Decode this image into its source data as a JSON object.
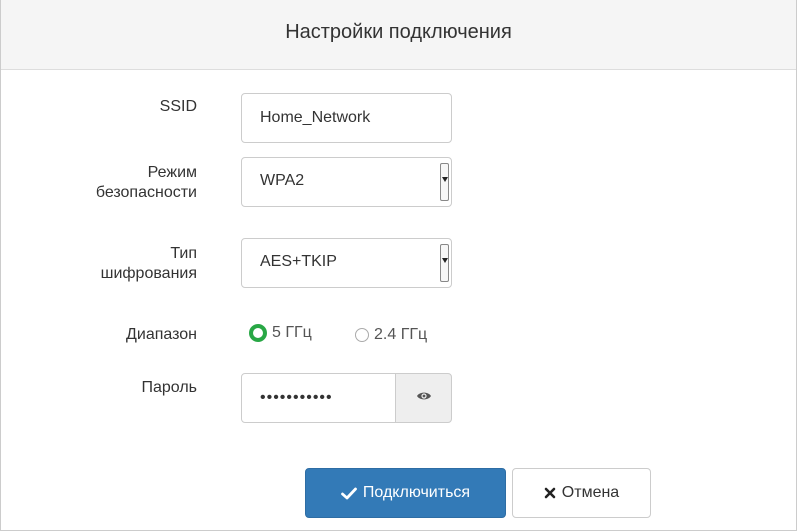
{
  "dialog": {
    "title": "Настройки подключения"
  },
  "form": {
    "ssid": {
      "label": "SSID",
      "value": "Home_Network"
    },
    "security": {
      "label_line1": "Режим",
      "label_line2": "безопасности",
      "value": "WPA2"
    },
    "encryption": {
      "label_line1": "Тип",
      "label_line2": "шифрования",
      "value": "AES+TKIP"
    },
    "band": {
      "label": "Диапазон",
      "options": [
        {
          "label": "5 ГГц",
          "checked": true
        },
        {
          "label": "2.4 ГГц",
          "checked": false
        }
      ]
    },
    "password": {
      "label": "Пароль",
      "value": "•••••••••••",
      "toggle_icon": "eye-icon"
    }
  },
  "buttons": {
    "connect": {
      "label": "Подключиться",
      "icon": "checkmark-icon",
      "color": "#337ab7"
    },
    "cancel": {
      "label": "Отмена",
      "icon": "close-icon"
    }
  },
  "colors": {
    "accent": "#337ab7",
    "radio_checked": "#28a745",
    "header_bg": "#f5f5f5"
  }
}
